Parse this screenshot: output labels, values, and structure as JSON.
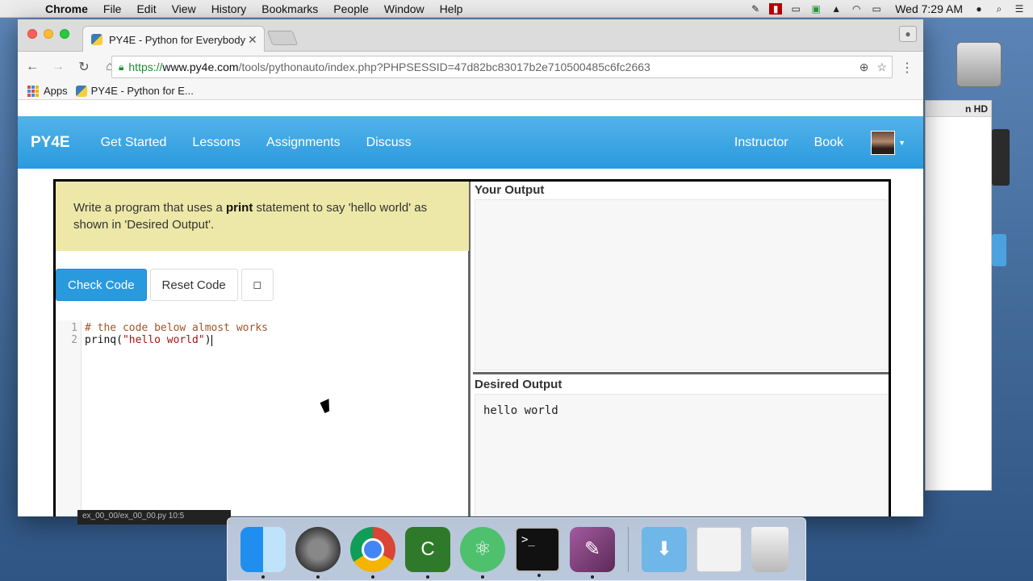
{
  "menubar": {
    "app": "Chrome",
    "items": [
      "File",
      "Edit",
      "View",
      "History",
      "Bookmarks",
      "People",
      "Window",
      "Help"
    ],
    "clock": "Wed 7:29 AM"
  },
  "finder_bg": {
    "title_fragment": "n HD"
  },
  "browser": {
    "tab_title": "PY4E - Python for Everybody",
    "url_scheme": "https://",
    "url_host": "www.py4e.com",
    "url_path": "/tools/pythonauto/index.php?PHPSESSID=47d82bc83017b2e710500485c6fc2663",
    "bookmarks": [
      "Apps",
      "PY4E - Python for E..."
    ]
  },
  "site": {
    "brand": "PY4E",
    "nav_left": [
      "Get Started",
      "Lessons",
      "Assignments",
      "Discuss"
    ],
    "nav_right": [
      "Instructor",
      "Book"
    ]
  },
  "exercise": {
    "instruction_pre": "Write a program that uses a ",
    "instruction_bold": "print",
    "instruction_post": " statement to say 'hello world' as shown in 'Desired Output'.",
    "check_label": "Check Code",
    "reset_label": "Reset Code",
    "square_label": "◻",
    "code_lines": [
      {
        "num": "1",
        "text": "# the code below almost works"
      },
      {
        "num": "2",
        "fn": "prinq(",
        "str": "\"hello world\"",
        "end": ")"
      }
    ],
    "your_output_label": "Your Output",
    "desired_output_label": "Desired Output",
    "desired_output_text": "hello world"
  },
  "taskbar_fragment": "ex_00_00/ex_00_00.py   10:5",
  "colors": {
    "navbar": "#2a9ade",
    "instructions_bg": "#ede8a8",
    "primary_button": "#2a9ade"
  },
  "dock": {
    "icons": [
      "finder-icon",
      "system-preferences-icon",
      "chrome-icon",
      "camtasia-icon",
      "atom-icon",
      "terminal-icon",
      "pdf-app-icon",
      "downloads-folder-icon",
      "documents-stack-icon",
      "trash-icon"
    ]
  }
}
